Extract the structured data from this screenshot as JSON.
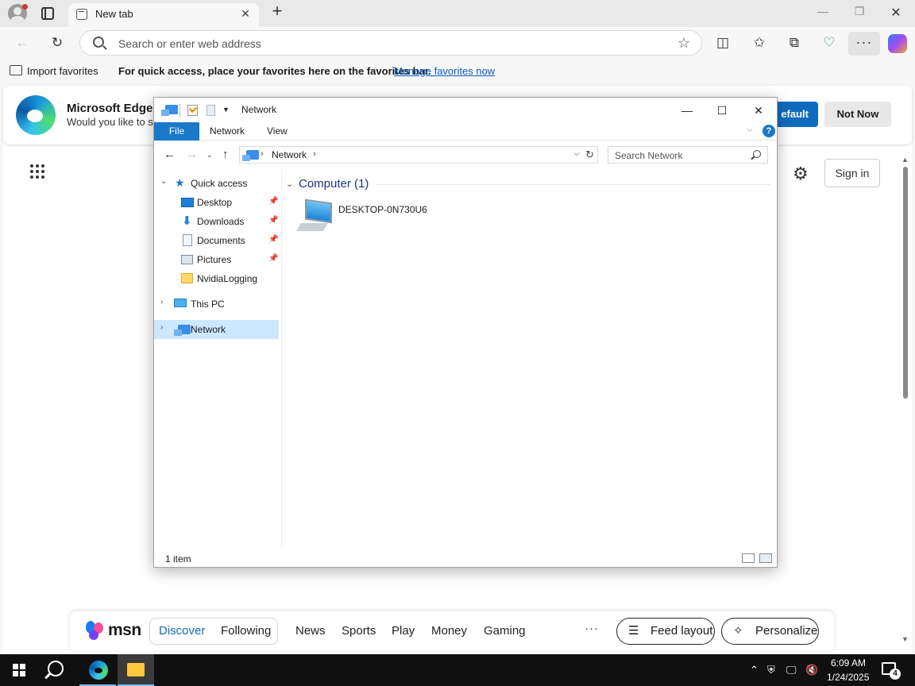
{
  "browser": {
    "tab_title": "New tab",
    "tab_close": "✕",
    "new_tab": "+",
    "address_placeholder": "Search or enter web address",
    "more_label": "···",
    "window_controls": {
      "minimize": "—",
      "restore": "❐",
      "close": "✕"
    }
  },
  "favorites_bar": {
    "import_label": "Import favorites",
    "prompt_text": "For quick access, place your favorites here on the favorites bar.",
    "manage_link": "Manage favorites now"
  },
  "banner": {
    "title": "Microsoft Edge",
    "subtitle": "Would you like to se",
    "default_button": "efault",
    "not_now_button": "Not Now"
  },
  "new_tab_page": {
    "sign_in": "Sign in"
  },
  "msn": {
    "logo_text": "msn",
    "tabs": [
      "Discover",
      "Following"
    ],
    "categories": [
      "News",
      "Sports",
      "Play",
      "Money",
      "Gaming"
    ],
    "more": "···",
    "feed_layout": "Feed layout",
    "personalize": "Personalize"
  },
  "explorer": {
    "title": "Network",
    "ribbon": {
      "file": "File",
      "network": "Network",
      "view": "View",
      "help": "?"
    },
    "breadcrumb": "Network",
    "search_placeholder": "Search Network",
    "window_controls": {
      "minimize": "—",
      "maximize": "☐",
      "close": "✕"
    },
    "nav_tree": [
      {
        "label": "Quick access"
      },
      {
        "label": "Desktop"
      },
      {
        "label": "Downloads"
      },
      {
        "label": "Documents"
      },
      {
        "label": "Pictures"
      },
      {
        "label": "NvidiaLogging"
      },
      {
        "label": "This PC"
      },
      {
        "label": "Network"
      }
    ],
    "group_header": "Computer (1)",
    "items": [
      {
        "name": "DESKTOP-0N730U6"
      }
    ],
    "status": "1 item"
  },
  "taskbar": {
    "time": "6:09 AM",
    "date": "1/24/2025",
    "notification_count": "4"
  },
  "colors": {
    "accent": "#0f6cbd",
    "explorer_file_tab": "#1979ca",
    "selection": "#cce8ff",
    "taskbar": "#101010"
  }
}
